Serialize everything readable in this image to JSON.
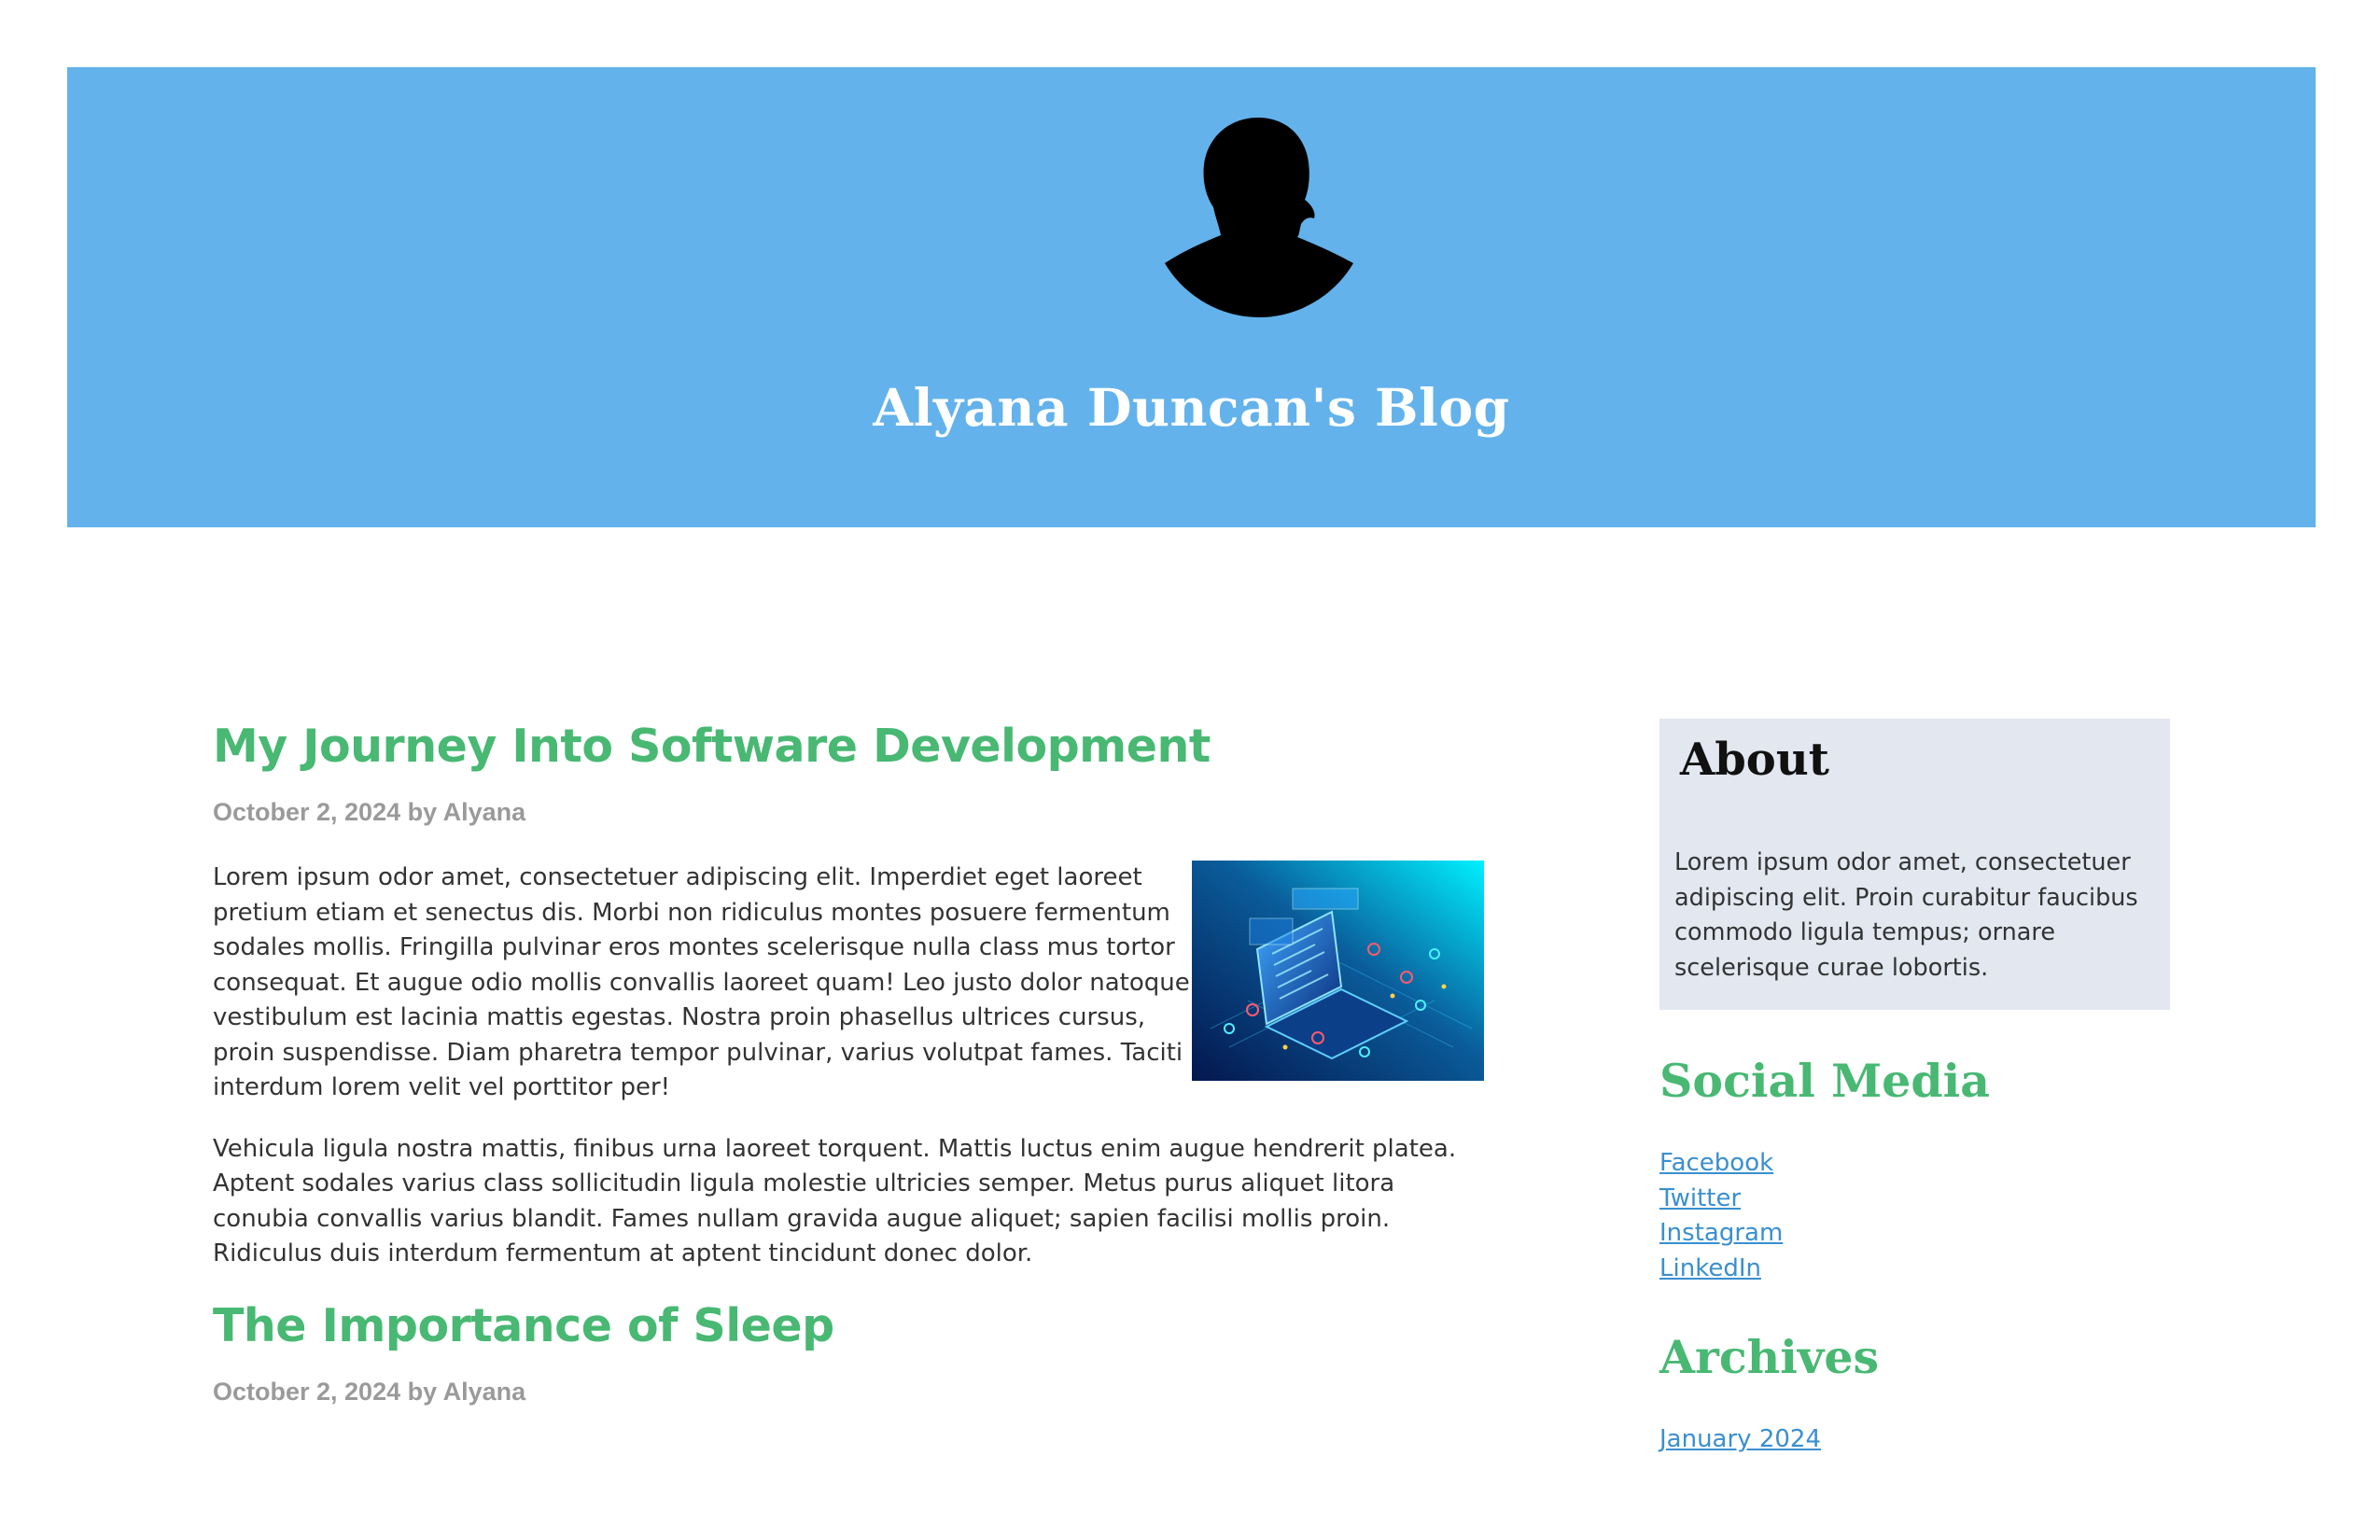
{
  "header": {
    "avatar_icon": "person-silhouette-icon",
    "title": "Alyana Duncan's Blog",
    "background_color": "#63b2eb"
  },
  "posts": [
    {
      "title": "My Journey Into Software Development",
      "meta": "October 2, 2024 by Alyana",
      "image_icon": "laptop-technology-illustration",
      "paragraphs": [
        "Lorem ipsum odor amet, consectetuer adipiscing elit. Imperdiet eget laoreet pretium etiam et senectus dis. Morbi non ridiculus montes posuere fermentum sodales mollis. Fringilla pulvinar eros montes scelerisque nulla class mus tortor consequat. Et augue odio mollis convallis laoreet quam! Leo justo dolor natoque vestibulum est lacinia mattis egestas. Nostra proin phasellus ultrices cursus, proin suspendisse. Diam pharetra tempor pulvinar, varius volutpat fames. Taciti interdum lorem velit vel porttitor per!",
        "Vehicula ligula nostra mattis, finibus urna laoreet torquent. Mattis luctus enim augue hendrerit platea. Aptent sodales varius class sollicitudin ligula molestie ultricies semper. Metus purus aliquet litora conubia convallis varius blandit. Fames nullam gravida augue aliquet; sapien facilisi mollis proin. Ridiculus duis interdum fermentum at aptent tincidunt donec dolor."
      ]
    },
    {
      "title": "The Importance of Sleep",
      "meta": "October 2, 2024 by Alyana"
    }
  ],
  "sidebar": {
    "about": {
      "heading": "About",
      "text": "Lorem ipsum odor amet, consectetuer adipiscing elit. Proin curabitur faucibus commodo ligula tempus; ornare scelerisque curae lobortis."
    },
    "social": {
      "heading": "Social Media",
      "links": [
        "Facebook",
        "Twitter",
        "Instagram",
        "LinkedIn"
      ]
    },
    "archives": {
      "heading": "Archives",
      "links": [
        "January 2024"
      ]
    }
  },
  "colors": {
    "accent_green": "#48b873",
    "link_blue": "#3a8fcf",
    "about_bg": "#e2e7f0",
    "meta_gray": "#9a9a9a"
  }
}
